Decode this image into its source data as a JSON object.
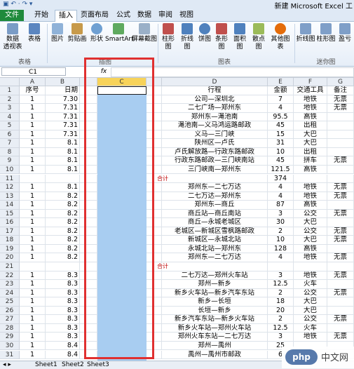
{
  "app": {
    "title": "新建 Microsoft Excel 工"
  },
  "tabs": [
    "文件",
    "开始",
    "插入",
    "页面布局",
    "公式",
    "数据",
    "审阅",
    "视图"
  ],
  "active_tab": "插入",
  "ribbon": {
    "buttons": [
      "数据\n透视表",
      "表格",
      "图片",
      "剪贴画",
      "形状",
      "SmartArt",
      "屏幕截图",
      "柱形图",
      "折线图",
      "饼图",
      "条形图",
      "面积图",
      "散点图",
      "其他图表",
      "折线图",
      "柱形图",
      "盈亏"
    ],
    "groups": [
      "表格",
      "插图",
      "图表",
      "迷你图"
    ]
  },
  "formula_bar": {
    "name_box": "C1",
    "fx": "fx"
  },
  "columns": [
    "A",
    "B",
    "C",
    "D",
    "E",
    "F",
    "G"
  ],
  "rows": [
    {
      "n": "1",
      "a": "序号",
      "b": "日期",
      "d": "行程",
      "e": "金额",
      "f": "交通工具",
      "g": "备注"
    },
    {
      "n": "2",
      "a": "1",
      "b": "7.30",
      "d": "公司—深圳北",
      "e": "7",
      "f": "地铁",
      "g": "无票"
    },
    {
      "n": "3",
      "a": "1",
      "b": "7.31",
      "d": "二七广场—郑州东",
      "e": "4",
      "f": "地铁",
      "g": "无票"
    },
    {
      "n": "4",
      "a": "1",
      "b": "7.31",
      "d": "郑州东—渑池南",
      "e": "95.5",
      "f": "高铁",
      "g": ""
    },
    {
      "n": "5",
      "a": "1",
      "b": "7.31",
      "d": "渑池南—义马鸿运路邮政",
      "e": "45",
      "f": "出租",
      "g": ""
    },
    {
      "n": "6",
      "a": "1",
      "b": "7.31",
      "d": "义马—三门峡",
      "e": "15",
      "f": "大巴",
      "g": ""
    },
    {
      "n": "7",
      "a": "1",
      "b": "8.1",
      "d": "陕州区—卢氏",
      "e": "31",
      "f": "大巴",
      "g": ""
    },
    {
      "n": "8",
      "a": "1",
      "b": "8.1",
      "d": "卢氏解放路—行政东路邮政",
      "e": "10",
      "f": "出租",
      "g": ""
    },
    {
      "n": "9",
      "a": "1",
      "b": "8.1",
      "d": "行政东路邮政—三门峡南站",
      "e": "45",
      "f": "拼车",
      "g": "无票"
    },
    {
      "n": "10",
      "a": "1",
      "b": "8.1",
      "d": "三门峡南—郑州东",
      "e": "121.5",
      "f": "高铁",
      "g": ""
    },
    {
      "n": "11",
      "a": "",
      "b": "",
      "d": "",
      "e": "374",
      "f": "",
      "g": ""
    },
    {
      "n": "12",
      "a": "1",
      "b": "8.1",
      "d": "郑州东—二七万达",
      "e": "4",
      "f": "地铁",
      "g": "无票"
    },
    {
      "n": "13",
      "a": "1",
      "b": "8.2",
      "d": "二七万达—郑州东",
      "e": "4",
      "f": "地铁",
      "g": "无票"
    },
    {
      "n": "14",
      "a": "1",
      "b": "8.2",
      "d": "郑州东—商丘",
      "e": "87",
      "f": "高铁",
      "g": ""
    },
    {
      "n": "15",
      "a": "1",
      "b": "8.2",
      "d": "商丘站—商丘南站",
      "e": "3",
      "f": "公交",
      "g": "无票"
    },
    {
      "n": "16",
      "a": "1",
      "b": "8.2",
      "d": "商丘—永城老城区",
      "e": "30",
      "f": "大巴",
      "g": ""
    },
    {
      "n": "17",
      "a": "1",
      "b": "8.2",
      "d": "老城区—新城区雪枫路邮政",
      "e": "2",
      "f": "公交",
      "g": "无票"
    },
    {
      "n": "18",
      "a": "1",
      "b": "8.2",
      "d": "新城区—永城北站",
      "e": "10",
      "f": "大巴",
      "g": "无票"
    },
    {
      "n": "19",
      "a": "1",
      "b": "8.2",
      "d": "永城北站—郑州东",
      "e": "128",
      "f": "高铁",
      "g": ""
    },
    {
      "n": "20",
      "a": "1",
      "b": "8.2",
      "d": "郑州东—二七万达",
      "e": "4",
      "f": "地铁",
      "g": "无票"
    },
    {
      "n": "21",
      "a": "",
      "b": "",
      "d": "",
      "e": "",
      "f": "",
      "g": ""
    },
    {
      "n": "22",
      "a": "1",
      "b": "8.3",
      "d": "二七万达—郑州火车站",
      "e": "3",
      "f": "地铁",
      "g": "无票"
    },
    {
      "n": "23",
      "a": "1",
      "b": "8.3",
      "d": "郑州—新乡",
      "e": "12.5",
      "f": "火车",
      "g": ""
    },
    {
      "n": "24",
      "a": "1",
      "b": "8.3",
      "d": "新乡火车站—新乡汽车东站",
      "e": "2",
      "f": "公交",
      "g": "无票"
    },
    {
      "n": "25",
      "a": "1",
      "b": "8.3",
      "d": "新乡—长垣",
      "e": "18",
      "f": "大巴",
      "g": ""
    },
    {
      "n": "26",
      "a": "1",
      "b": "8.3",
      "d": "长垣—新乡",
      "e": "20",
      "f": "大巴",
      "g": ""
    },
    {
      "n": "27",
      "a": "1",
      "b": "8.3",
      "d": "新乡汽车东站—新乡火车站",
      "e": "2",
      "f": "公交",
      "g": "无票"
    },
    {
      "n": "28",
      "a": "1",
      "b": "8.3",
      "d": "新乡火车站—郑州火车站",
      "e": "12.5",
      "f": "火车",
      "g": ""
    },
    {
      "n": "29",
      "a": "1",
      "b": "8.3",
      "d": "郑州火车东站—二七万达",
      "e": "3",
      "f": "地铁",
      "g": "无票"
    },
    {
      "n": "30",
      "a": "1",
      "b": "8.4",
      "d": "郑州—禹州",
      "e": "25",
      "f": "",
      "g": ""
    },
    {
      "n": "31",
      "a": "1",
      "b": "8.4",
      "d": "禹州—禹州市邮政",
      "e": "6",
      "f": "",
      "g": ""
    }
  ],
  "row11_note": "合计",
  "row21_note": "合计",
  "sheets": [
    "Sheet1",
    "Sheet2",
    "Sheet3"
  ],
  "watermark": {
    "logo": "php",
    "text": "中文网"
  }
}
